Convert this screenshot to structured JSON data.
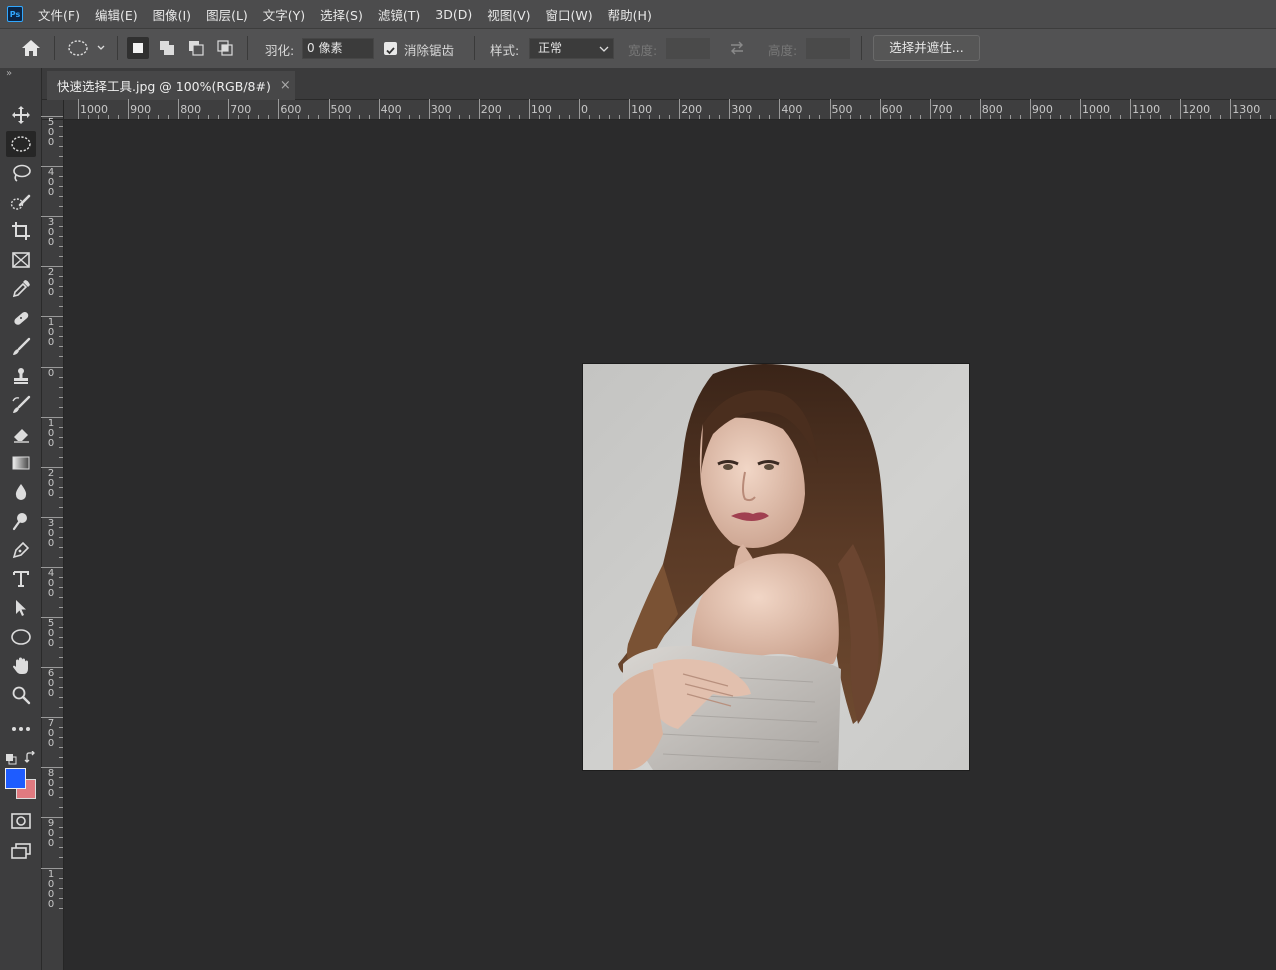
{
  "app": {
    "logo_text": "Ps"
  },
  "menu": [
    "文件(F)",
    "编辑(E)",
    "图像(I)",
    "图层(L)",
    "文字(Y)",
    "选择(S)",
    "滤镜(T)",
    "3D(D)",
    "视图(V)",
    "窗口(W)",
    "帮助(H)"
  ],
  "options_bar": {
    "feather_label": "羽化:",
    "feather_value": "0 像素",
    "anti_alias_label": "消除锯齿",
    "anti_alias_checked": true,
    "style_label": "样式:",
    "style_value": "正常",
    "width_label": "宽度:",
    "height_label": "高度:",
    "refine_button": "选择并遮住..."
  },
  "document_tab": {
    "title": "快速选择工具.jpg @ 100%(RGB/8#)",
    "close": "×"
  },
  "rulers": {
    "horizontal": [
      "1000",
      "900",
      "800",
      "700",
      "600",
      "500",
      "400",
      "300",
      "200",
      "100",
      "0",
      "100",
      "200",
      "300",
      "400",
      "500",
      "600",
      "700",
      "800",
      "900",
      "1000",
      "1100",
      "1200",
      "1300"
    ],
    "vertical": [
      "500",
      "400",
      "300",
      "200",
      "100",
      "0",
      "100",
      "200",
      "300",
      "400",
      "500",
      "600",
      "700",
      "800",
      "900",
      "1000"
    ]
  },
  "tools": [
    {
      "name": "move-tool",
      "icon": "move-icon"
    },
    {
      "name": "elliptical-marquee-tool",
      "icon": "ellipse-marquee-icon",
      "active": true
    },
    {
      "name": "lasso-tool",
      "icon": "lasso-icon"
    },
    {
      "name": "quick-selection-tool",
      "icon": "quick-selection-icon"
    },
    {
      "name": "crop-tool",
      "icon": "crop-icon"
    },
    {
      "name": "frame-tool",
      "icon": "frame-icon"
    },
    {
      "name": "eyedropper-tool",
      "icon": "eyedropper-icon"
    },
    {
      "name": "healing-brush-tool",
      "icon": "bandage-icon"
    },
    {
      "name": "brush-tool",
      "icon": "brush-icon"
    },
    {
      "name": "clone-stamp-tool",
      "icon": "stamp-icon"
    },
    {
      "name": "history-brush-tool",
      "icon": "history-brush-icon"
    },
    {
      "name": "eraser-tool",
      "icon": "eraser-icon"
    },
    {
      "name": "gradient-tool",
      "icon": "gradient-icon"
    },
    {
      "name": "blur-tool",
      "icon": "drop-icon"
    },
    {
      "name": "dodge-tool",
      "icon": "dodge-icon"
    },
    {
      "name": "pen-tool",
      "icon": "pen-icon"
    },
    {
      "name": "type-tool",
      "icon": "type-icon"
    },
    {
      "name": "path-selection-tool",
      "icon": "arrow-icon"
    },
    {
      "name": "ellipse-tool",
      "icon": "ellipse-shape-icon"
    },
    {
      "name": "hand-tool",
      "icon": "hand-icon"
    },
    {
      "name": "zoom-tool",
      "icon": "zoom-icon"
    },
    {
      "name": "edit-toolbar",
      "icon": "ellipsis-icon"
    }
  ],
  "colors": {
    "foreground": "#1e5cff",
    "background": "#e07a80",
    "app_bg": "#2b2b2c",
    "photo_bg": "#cdcdcb"
  }
}
